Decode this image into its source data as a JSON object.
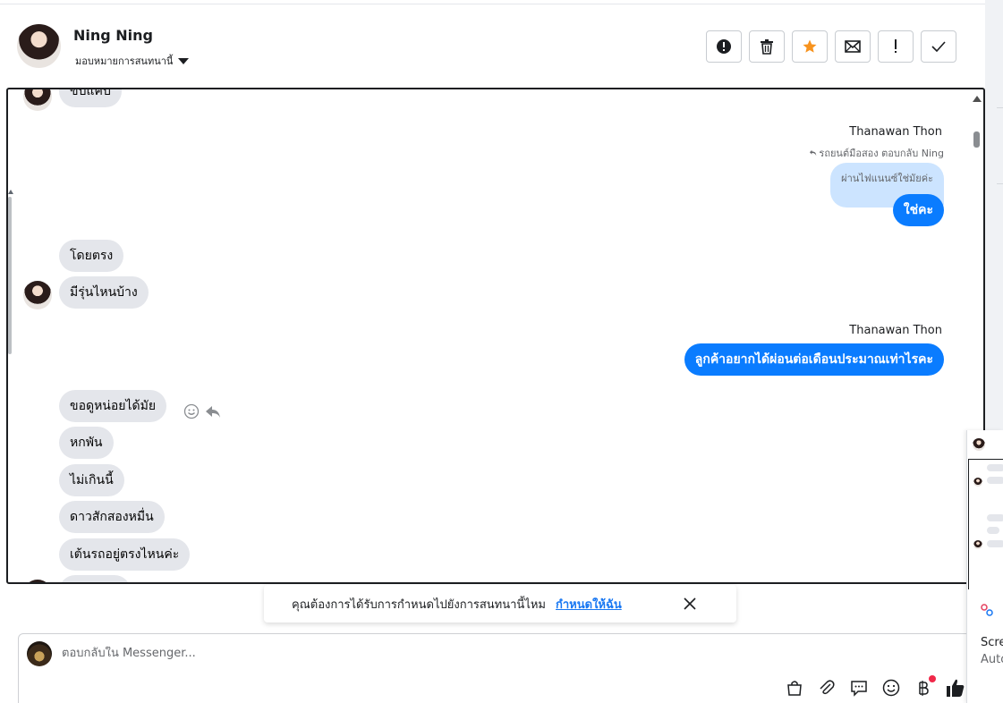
{
  "header": {
    "contact_name": "Ning Ning",
    "assign_label": "มอบหมายการสนทนานี้"
  },
  "toolbar": {
    "buttons": [
      {
        "name": "spam",
        "icon": "alert-circle-icon"
      },
      {
        "name": "delete",
        "icon": "trash-icon"
      },
      {
        "name": "star",
        "icon": "star-icon",
        "color": "#f7931e"
      },
      {
        "name": "mark-unread",
        "icon": "envelope-icon"
      },
      {
        "name": "follow-up",
        "icon": "exclamation-icon"
      },
      {
        "name": "done",
        "icon": "checkmark-icon"
      }
    ]
  },
  "messages": {
    "m0": "ขับแคป",
    "sender1": "Thanawan Thon",
    "reply_meta": "รถยนต์มือสอง ตอบกลับ Ning",
    "quoted": "ผ่านไฟแนนซ์ใช่มัยค่ะ",
    "m1": "ใช่คะ",
    "m2": "โดยตรง",
    "m3": "มีรุ่นไหนบ้าง",
    "sender2": "Thanawan Thon",
    "m4": "ลูกค้าอยากได้ผ่อนต่อเดือนประมาณเท่าไรคะ",
    "m5": "ขอดูหน่อยได้มัย",
    "m6": "หกพัน",
    "m7": "ไม่เกินนี้",
    "m8": "ดาวสักสองหมื่น",
    "m9": "เต้นรถอยู่ตรงไหนค่ะ"
  },
  "banner": {
    "text": "คุณต้องการได้รับการกำหนดไปยังการสนทนานี้ไหม",
    "link": "กำหนดให้ฉัน"
  },
  "composer": {
    "placeholder": "ตอบกลับใน Messenger..."
  },
  "mini_panel": {
    "label_line1": "Scre",
    "label_line2": "Auto"
  },
  "colors": {
    "outgoing_bubble": "#0a7cff",
    "incoming_bubble": "#e4e6eb",
    "quote_bubble": "#cce4ff",
    "link": "#1877f2",
    "star": "#f7931e"
  }
}
